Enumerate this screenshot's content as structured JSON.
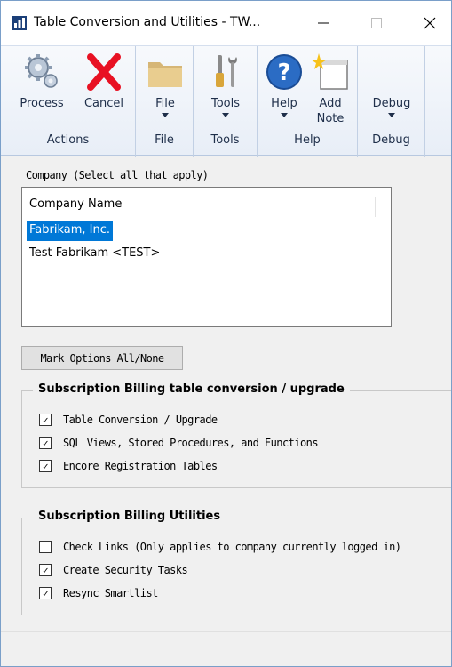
{
  "window": {
    "title": "Table Conversion and Utilities  -  TW..."
  },
  "ribbon": {
    "groups": [
      {
        "label": "Actions",
        "buttons": [
          {
            "label": "Process",
            "icon": "gears-icon"
          },
          {
            "label": "Cancel",
            "icon": "red-x-icon"
          }
        ]
      },
      {
        "label": "File",
        "buttons": [
          {
            "label": "File",
            "icon": "folder-icon"
          }
        ]
      },
      {
        "label": "Tools",
        "buttons": [
          {
            "label": "Tools",
            "icon": "tools-icon"
          }
        ]
      },
      {
        "label": "Help",
        "buttons": [
          {
            "label": "Help",
            "icon": "help-icon"
          },
          {
            "label": "Add\nNote",
            "label_line1": "Add",
            "label_line2": "Note",
            "icon": "note-icon"
          }
        ]
      },
      {
        "label": "Debug",
        "buttons": [
          {
            "label": "Debug",
            "icon": ""
          }
        ]
      }
    ]
  },
  "company": {
    "label": "Company (Select all that apply)",
    "column_header": "Company Name",
    "items": [
      {
        "name": "Fabrikam, Inc.",
        "selected": true
      },
      {
        "name": "Test Fabrikam <TEST>",
        "selected": false
      }
    ]
  },
  "mark_options_button": "Mark Options All/None",
  "conversion_group": {
    "title": "Subscription Billing table conversion / upgrade",
    "options": [
      {
        "label": "Table Conversion / Upgrade",
        "checked": true
      },
      {
        "label": "SQL Views, Stored Procedures, and Functions",
        "checked": true
      },
      {
        "label": "Encore Registration Tables",
        "checked": true
      }
    ]
  },
  "utilities_group": {
    "title": "Subscription Billing Utilities",
    "options": [
      {
        "label": "Check Links (Only applies to company currently logged in)",
        "checked": false
      },
      {
        "label": "Create Security Tasks",
        "checked": true
      },
      {
        "label": "Resync Smartlist",
        "checked": true
      }
    ]
  },
  "colors": {
    "selection": "#0078d7",
    "ribbon_text": "#1f2f4a",
    "cancel_red": "#e81123",
    "help_blue": "#2b6cc4"
  }
}
